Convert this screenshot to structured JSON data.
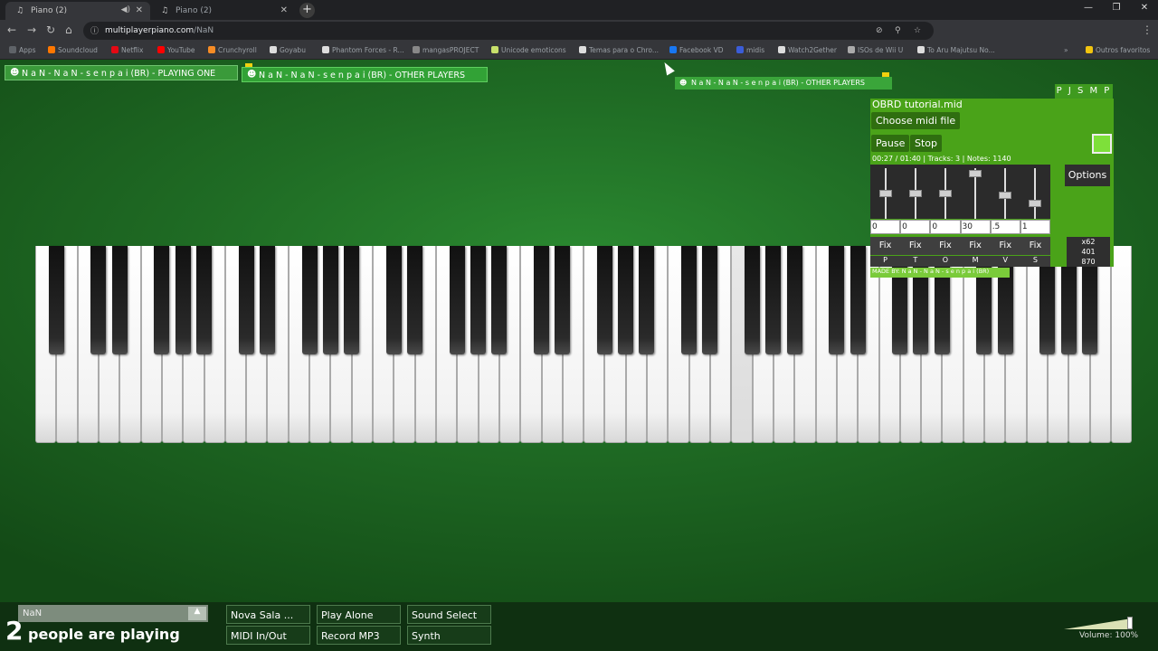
{
  "browser": {
    "tabs": [
      {
        "title": "Piano (2)",
        "active": true
      },
      {
        "title": "Piano (2)",
        "active": false
      }
    ],
    "url_host": "multiplayerpiano.com",
    "url_path": "/NaN",
    "bookmarks": [
      {
        "label": "Apps",
        "color": "#5f6368"
      },
      {
        "label": "Soundcloud",
        "color": "#ff7700"
      },
      {
        "label": "Netflix",
        "color": "#e50914"
      },
      {
        "label": "YouTube",
        "color": "#ff0000"
      },
      {
        "label": "Crunchyroll",
        "color": "#f78c25"
      },
      {
        "label": "Goyabu",
        "color": "#dddddd"
      },
      {
        "label": "Phantom Forces - R...",
        "color": "#dddddd"
      },
      {
        "label": "mangasPROJECT",
        "color": "#888888"
      },
      {
        "label": "Unicode emoticons",
        "color": "#c8e06b"
      },
      {
        "label": "Temas para o Chro...",
        "color": "#dddddd"
      },
      {
        "label": "Facebook VD",
        "color": "#1877f2"
      },
      {
        "label": "midis",
        "color": "#3b5dd8"
      },
      {
        "label": "Watch2Gether",
        "color": "#dddddd"
      },
      {
        "label": "ISOs de Wii U",
        "color": "#aaaaaa"
      },
      {
        "label": "To Aru Majutsu No...",
        "color": "#dddddd"
      },
      {
        "label": "Outros favoritos",
        "color": "#f1c40f"
      }
    ]
  },
  "players": {
    "playing_one": "N a N - N a N - s e n p a i  (BR) - PLAYING ONE",
    "other_players": "N a N - N a N - s e n p a i  (BR) - OTHER PLAYERS",
    "other_players_small": "N a N - N a N - s e n p a i  (BR) - OTHER PLAYERS"
  },
  "midi_panel": {
    "title": "OBRD tutorial.mid",
    "choose": "Choose midi file",
    "pause": "Pause",
    "stop": "Stop",
    "status": "00:27 / 01:40 | Tracks: 3 | Notes: 1140",
    "options": "Options",
    "corner_label": "P J S M P",
    "inputs": [
      "0",
      "0",
      "0",
      "30",
      ".5",
      "1"
    ],
    "fix_label": "Fix",
    "letters": [
      "P",
      "T",
      "O",
      "M",
      "V",
      "S"
    ],
    "stats": [
      "x62",
      "401",
      "870"
    ],
    "made_by": "MADE BY: N a N - N a N - s e n p a i (BR)",
    "slider_levels": [
      0.55,
      0.55,
      0.55,
      0.05,
      0.6,
      0.8
    ]
  },
  "bottom": {
    "name_value": "NaN",
    "people_count": "2",
    "people_text": "people are playing",
    "buttons": {
      "nova_sala": "Nova Sala ...",
      "play_alone": "Play Alone",
      "sound_select": "Sound Select",
      "midi_inout": "MIDI In/Out",
      "record_mp3": "Record MP3",
      "synth": "Synth"
    },
    "volume_label": "Volume: 100%",
    "volume_level": 1.0
  },
  "colors": {
    "panel_green": "#4aa319",
    "bg_green": "#1f6b24"
  }
}
